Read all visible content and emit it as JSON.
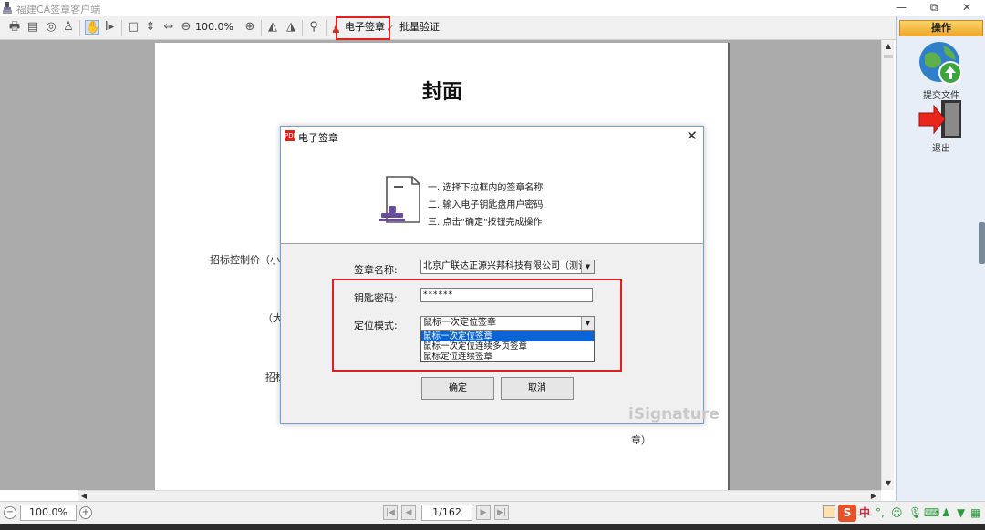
{
  "window": {
    "title": "福建CA签章客户端",
    "controls": [
      "—",
      "⧉",
      "✕"
    ]
  },
  "toolbar": {
    "zoom_value": "100.0%",
    "esign_label": "电子签章",
    "batch_verify_label": "批量验证",
    "highlight_color": "#e02020"
  },
  "document": {
    "heading": "封面",
    "fragments": [
      "招标控制价（小写",
      "（大写",
      "招标",
      "章）"
    ]
  },
  "side_panel": {
    "header": "操作",
    "items": [
      {
        "label": "提交文件",
        "icon": "globe-submit-icon"
      },
      {
        "label": "退出",
        "icon": "exit-door-icon"
      }
    ]
  },
  "dialog": {
    "title": "电子签章",
    "icon_text": "PDF",
    "steps": [
      "一. 选择下拉框内的签章名称",
      "二. 输入电子钥匙盘用户密码",
      "三. 点击\"确定\"按钮完成操作"
    ],
    "seal_name_label": "签章名称:",
    "seal_name_value": "北京广联达正源兴邦科技有限公司（测试）",
    "password_label": "钥匙密码:",
    "password_value": "******",
    "mode_label": "定位模式:",
    "mode_value": "鼠标一次定位签章",
    "mode_options": [
      "鼠标一次定位签章",
      "鼠标一次定位连续多页签章",
      "鼠标定位连续签章"
    ],
    "ok_label": "确定",
    "cancel_label": "取消",
    "watermark": "iSignature"
  },
  "statusbar": {
    "zoom_value": "100.0%",
    "page_indicator": "1/162"
  },
  "tray": {
    "ime_label": "中"
  }
}
